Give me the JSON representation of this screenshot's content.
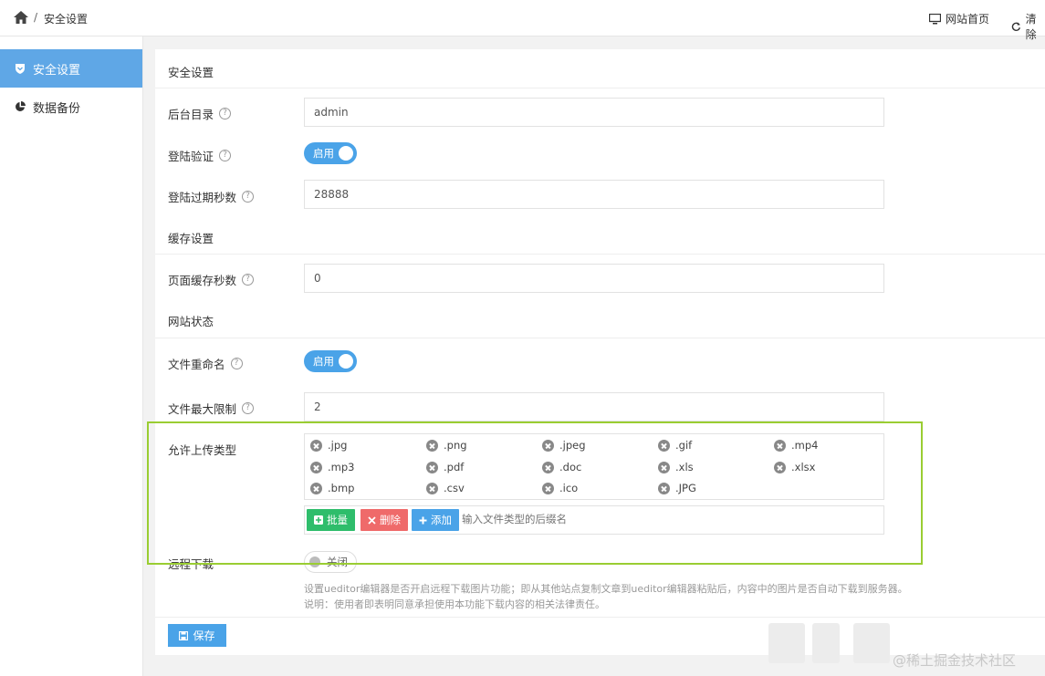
{
  "breadcrumb": {
    "separator": "/",
    "current": "安全设置"
  },
  "top_nav": {
    "home_link": "网站首页",
    "clear_link": "清除"
  },
  "sidebar": {
    "items": [
      {
        "label": "安全设置",
        "icon": "shield-icon",
        "active": true
      },
      {
        "label": "数据备份",
        "icon": "pie-chart-icon",
        "active": false
      }
    ]
  },
  "security": {
    "section_title": "安全设置",
    "admin_dir": {
      "label": "后台目录",
      "value": "admin"
    },
    "login_verify": {
      "label": "登陆验证",
      "switch_text": "启用"
    },
    "login_expire": {
      "label": "登陆过期秒数",
      "value": "28888"
    }
  },
  "cache": {
    "section_title": "缓存设置",
    "page_cache": {
      "label": "页面缓存秒数",
      "value": "0"
    }
  },
  "site_status": {
    "section_title": "网站状态",
    "file_rename": {
      "label": "文件重命名",
      "switch_text": "启用"
    },
    "file_max": {
      "label": "文件最大限制",
      "value": "2"
    },
    "upload_types": {
      "label": "允许上传类型",
      "types": [
        ".jpg",
        ".png",
        ".jpeg",
        ".gif",
        ".mp4",
        ".mp3",
        ".pdf",
        ".doc",
        ".xls",
        ".xlsx",
        ".bmp",
        ".csv",
        ".ico",
        ".JPG"
      ],
      "batch_label": "批量",
      "delete_label": "删除",
      "add_label": "添加",
      "suffix_placeholder": "输入文件类型的后缀名"
    },
    "remote_download": {
      "label": "远程下载",
      "switch_text": "关闭",
      "description": "设置ueditor编辑器是否开启远程下载图片功能；即从其他站点复制文章到ueditor编辑器粘贴后，内容中的图片是否自动下载到服务器。",
      "note": "说明：使用者即表明同意承担使用本功能下载内容的相关法律责任。"
    }
  },
  "save_label": "保存",
  "watermark": "@稀土掘金技术社区",
  "colors": {
    "accent": "#4aa3e8",
    "sidebar_active": "#5fa7e6",
    "green": "#2ebd6b",
    "red": "#ef6a6a",
    "highlight": "#9acd32"
  }
}
